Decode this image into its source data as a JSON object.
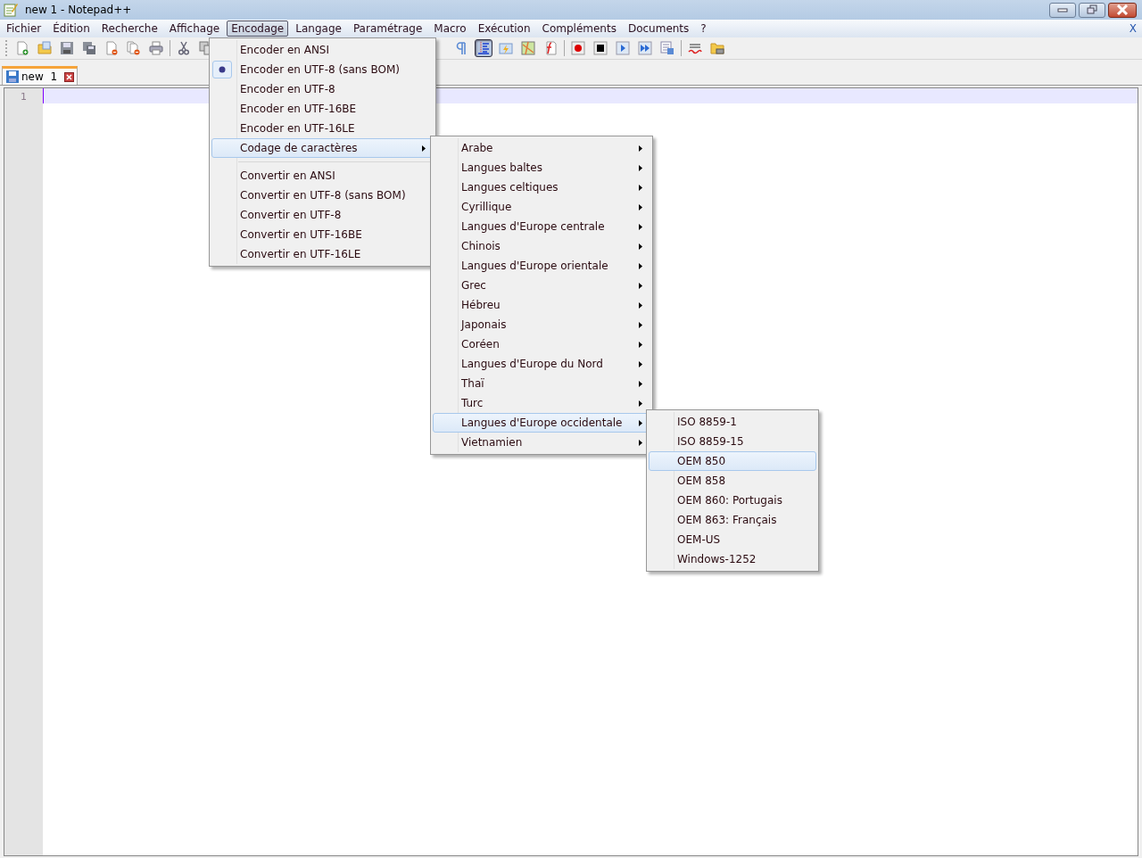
{
  "window": {
    "title": "new 1 - Notepad++"
  },
  "menubar": {
    "items": [
      {
        "label": "Fichier",
        "selected": false
      },
      {
        "label": "Édition",
        "selected": false
      },
      {
        "label": "Recherche",
        "selected": false
      },
      {
        "label": "Affichage",
        "selected": false
      },
      {
        "label": "Encodage",
        "selected": true
      },
      {
        "label": "Langage",
        "selected": false
      },
      {
        "label": "Paramétrage",
        "selected": false
      },
      {
        "label": "Macro",
        "selected": false
      },
      {
        "label": "Exécution",
        "selected": false
      },
      {
        "label": "Compléments",
        "selected": false
      },
      {
        "label": "Documents",
        "selected": false
      },
      {
        "label": "?",
        "selected": false
      }
    ],
    "close_doc": "X"
  },
  "toolbar": [
    {
      "kind": "new",
      "pressed": false
    },
    {
      "kind": "open",
      "pressed": false
    },
    {
      "kind": "save",
      "pressed": false
    },
    {
      "kind": "saveall",
      "pressed": false
    },
    {
      "kind": "close",
      "pressed": false
    },
    {
      "kind": "closeall",
      "pressed": false
    },
    {
      "kind": "print",
      "pressed": false
    },
    {
      "kind": "sep"
    },
    {
      "kind": "cut",
      "pressed": false
    },
    {
      "kind": "copy",
      "pressed": false
    },
    {
      "kind": "gap"
    },
    {
      "kind": "pilcrow",
      "pressed": false
    },
    {
      "kind": "wrap",
      "pressed": true
    },
    {
      "kind": "panel",
      "pressed": false
    },
    {
      "kind": "map",
      "pressed": false
    },
    {
      "kind": "func",
      "pressed": false
    },
    {
      "kind": "sep"
    },
    {
      "kind": "record",
      "pressed": false
    },
    {
      "kind": "stop",
      "pressed": false
    },
    {
      "kind": "play",
      "pressed": false
    },
    {
      "kind": "playmulti",
      "pressed": false
    },
    {
      "kind": "savemacro",
      "pressed": false
    },
    {
      "kind": "sep"
    },
    {
      "kind": "spell",
      "pressed": false
    },
    {
      "kind": "folder",
      "pressed": false
    }
  ],
  "tabs": [
    {
      "label": "new  1",
      "selected": true
    }
  ],
  "editor": {
    "line_numbers": [
      "1"
    ]
  },
  "encoding_menu": [
    {
      "kind": "item",
      "label": "Encoder en ANSI",
      "checked": false,
      "selected": false
    },
    {
      "kind": "item",
      "label": "Encoder en UTF-8 (sans BOM)",
      "checked": true,
      "selected": false
    },
    {
      "kind": "item",
      "label": "Encoder en UTF-8",
      "checked": false,
      "selected": false
    },
    {
      "kind": "item",
      "label": "Encoder en UTF-16BE",
      "checked": false,
      "selected": false
    },
    {
      "kind": "item",
      "label": "Encoder en UTF-16LE",
      "checked": false,
      "selected": false
    },
    {
      "kind": "submenu",
      "label": "Codage de caractères",
      "checked": false,
      "selected": true
    },
    {
      "kind": "separator"
    },
    {
      "kind": "item",
      "label": "Convertir en ANSI",
      "checked": false,
      "selected": false
    },
    {
      "kind": "item",
      "label": "Convertir en UTF-8 (sans BOM)",
      "checked": false,
      "selected": false
    },
    {
      "kind": "item",
      "label": "Convertir en UTF-8",
      "checked": false,
      "selected": false
    },
    {
      "kind": "item",
      "label": "Convertir en UTF-16BE",
      "checked": false,
      "selected": false
    },
    {
      "kind": "item",
      "label": "Convertir en UTF-16LE",
      "checked": false,
      "selected": false
    }
  ],
  "charset_menu": [
    {
      "kind": "submenu",
      "label": "Arabe",
      "selected": false
    },
    {
      "kind": "submenu",
      "label": "Langues baltes",
      "selected": false
    },
    {
      "kind": "submenu",
      "label": "Langues celtiques",
      "selected": false
    },
    {
      "kind": "submenu",
      "label": "Cyrillique",
      "selected": false
    },
    {
      "kind": "submenu",
      "label": "Langues d'Europe centrale",
      "selected": false
    },
    {
      "kind": "submenu",
      "label": "Chinois",
      "selected": false
    },
    {
      "kind": "submenu",
      "label": "Langues d'Europe orientale",
      "selected": false
    },
    {
      "kind": "submenu",
      "label": "Grec",
      "selected": false
    },
    {
      "kind": "submenu",
      "label": "Hébreu",
      "selected": false
    },
    {
      "kind": "submenu",
      "label": "Japonais",
      "selected": false
    },
    {
      "kind": "submenu",
      "label": "Coréen",
      "selected": false
    },
    {
      "kind": "submenu",
      "label": "Langues d'Europe du Nord",
      "selected": false
    },
    {
      "kind": "submenu",
      "label": "Thaï",
      "selected": false
    },
    {
      "kind": "submenu",
      "label": "Turc",
      "selected": false
    },
    {
      "kind": "submenu",
      "label": "Langues d'Europe occidentale",
      "selected": true
    },
    {
      "kind": "submenu",
      "label": "Vietnamien",
      "selected": false
    }
  ],
  "western_menu": [
    {
      "kind": "item",
      "label": "ISO 8859-1",
      "selected": false
    },
    {
      "kind": "item",
      "label": "ISO 8859-15",
      "selected": false
    },
    {
      "kind": "item",
      "label": "OEM 850",
      "selected": true
    },
    {
      "kind": "item",
      "label": "OEM 858",
      "selected": false
    },
    {
      "kind": "item",
      "label": "OEM 860: Portugais",
      "selected": false
    },
    {
      "kind": "item",
      "label": "OEM 863: Français",
      "selected": false
    },
    {
      "kind": "item",
      "label": "OEM-US",
      "selected": false
    },
    {
      "kind": "item",
      "label": "Windows-1252",
      "selected": false
    }
  ]
}
